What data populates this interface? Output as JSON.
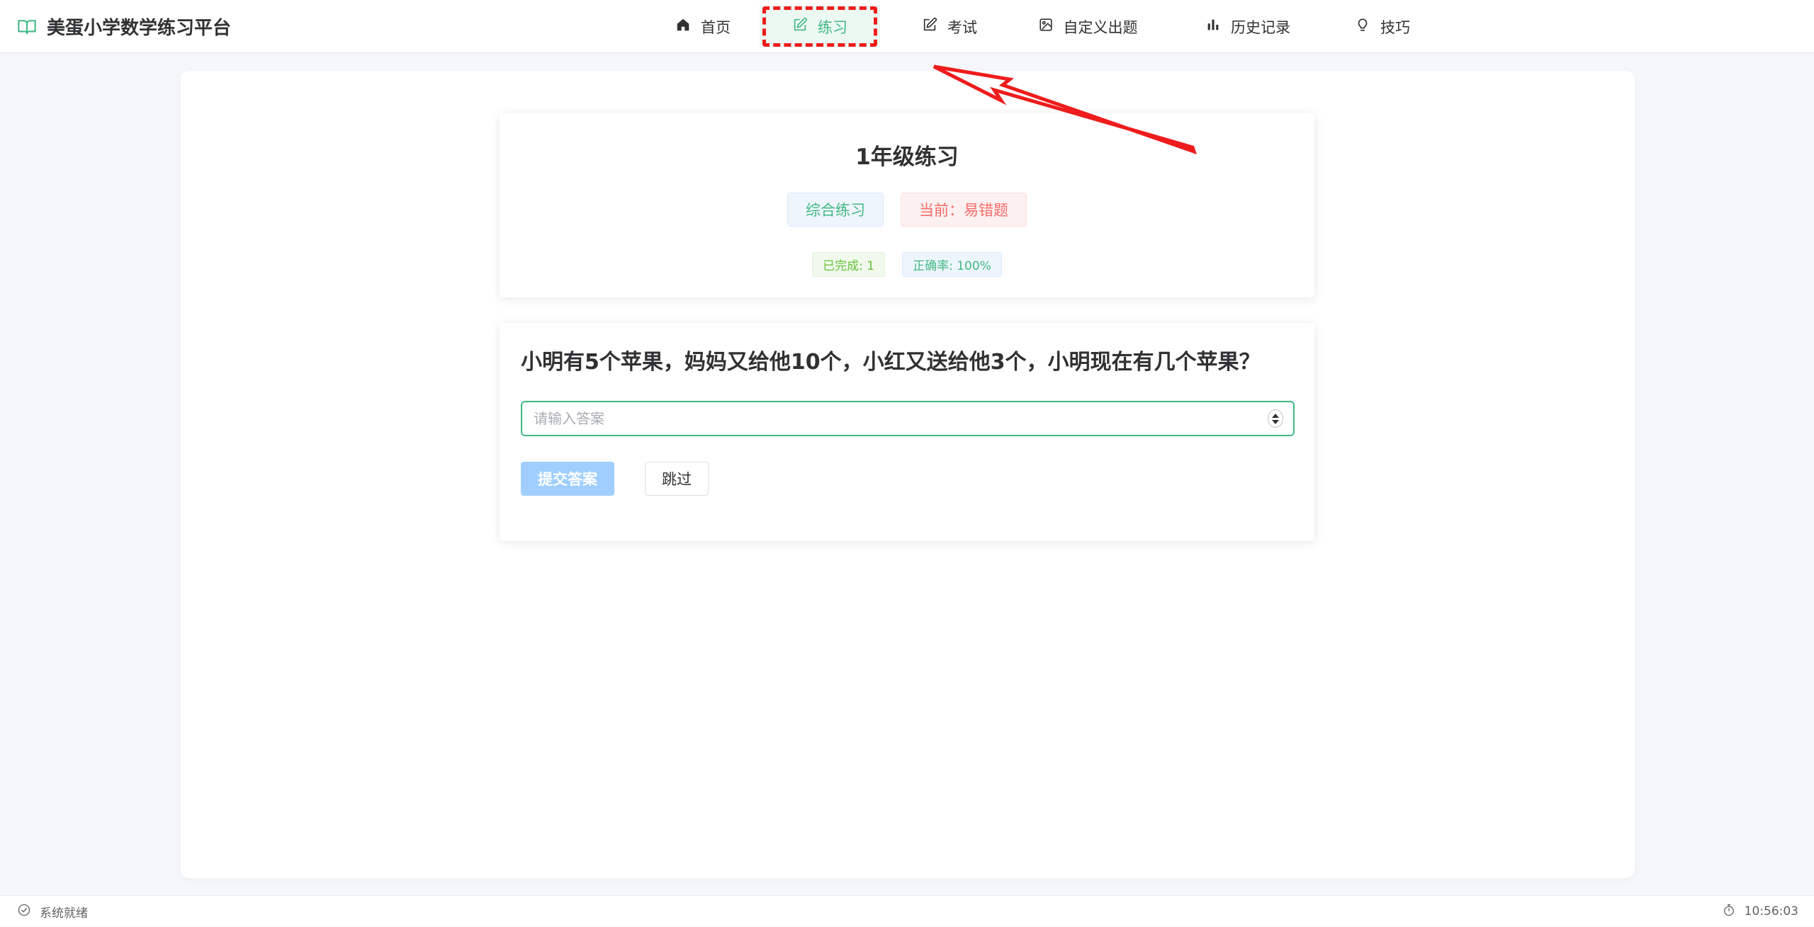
{
  "app": {
    "title": "美蛋小学数学练习平台",
    "brand_icon": "book-icon",
    "accent_color": "#42b883"
  },
  "nav": {
    "items": [
      {
        "label": "首页",
        "icon": "home-icon",
        "active": false
      },
      {
        "label": "练习",
        "icon": "edit-icon",
        "active": true
      },
      {
        "label": "考试",
        "icon": "edit-icon",
        "active": false
      },
      {
        "label": "自定义出题",
        "icon": "picture-icon",
        "active": false
      },
      {
        "label": "历史记录",
        "icon": "bar-chart-icon",
        "active": false
      },
      {
        "label": "技巧",
        "icon": "lightbulb-icon",
        "active": false
      }
    ]
  },
  "practice": {
    "title": "1年级练习",
    "mode_tag": "综合练习",
    "current_tag": "当前：易错题",
    "completed": "已完成: 1",
    "accuracy": "正确率: 100%"
  },
  "question": {
    "text": "小明有5个苹果，妈妈又给他10个，小红又送给他3个，小明现在有几个苹果？",
    "answer_placeholder": "请输入答案",
    "answer_value": "",
    "submit_label": "提交答案",
    "submit_disabled": true,
    "skip_label": "跳过"
  },
  "status": {
    "text": "系统就绪",
    "time": "10:56:03"
  },
  "annotation": {
    "highlight_color": "#ee1c1c"
  }
}
